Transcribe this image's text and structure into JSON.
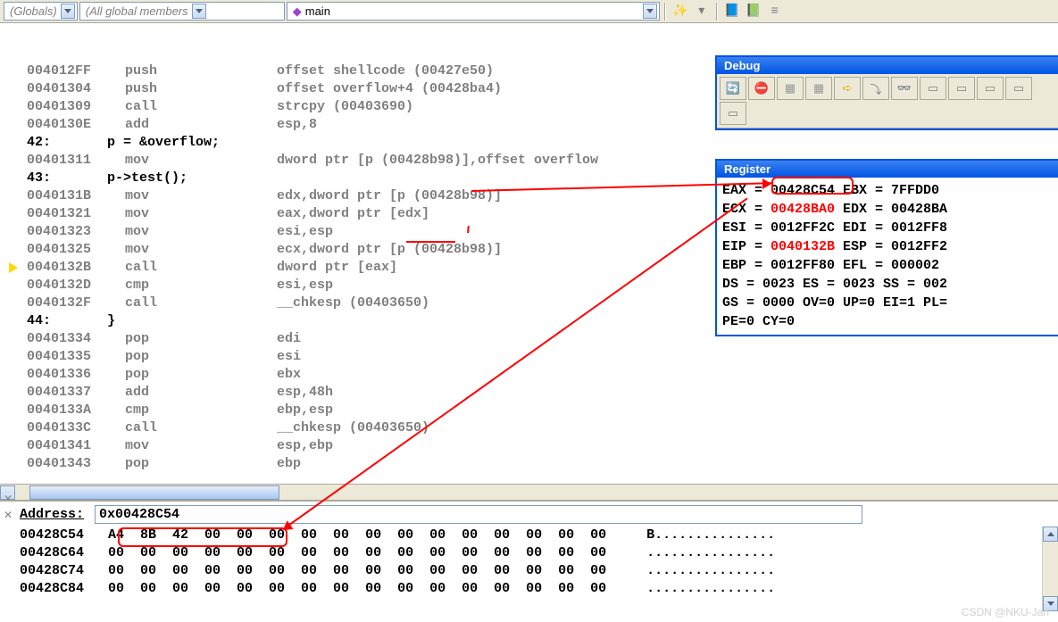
{
  "toolbar": {
    "combo1": "(Globals)",
    "combo2": "(All global members",
    "combo3": "main",
    "icons": [
      "wand-icon",
      "dropdown-icon",
      "book1-icon",
      "book2-icon",
      "list-icon"
    ]
  },
  "disasm": [
    {
      "addr": "004012FF",
      "mnem": "push",
      "oper": "offset shellcode (00427e50)"
    },
    {
      "addr": "00401304",
      "mnem": "push",
      "oper": "offset overflow+4 (00428ba4)"
    },
    {
      "addr": "00401309",
      "mnem": "call",
      "oper": "strcpy (00403690)"
    },
    {
      "addr": "0040130E",
      "mnem": "add",
      "oper": "esp,8"
    },
    {
      "src": "42:       p = &overflow;"
    },
    {
      "addr": "00401311",
      "mnem": "mov",
      "oper": "dword ptr [p (00428b98)],offset overflow"
    },
    {
      "src": "43:       p->test();"
    },
    {
      "addr": "0040131B",
      "mnem": "mov",
      "oper": "edx,dword ptr [p (00428b98)]"
    },
    {
      "addr": "00401321",
      "mnem": "mov",
      "oper": "eax,dword ptr [edx]"
    },
    {
      "addr": "00401323",
      "mnem": "mov",
      "oper": "esi,esp"
    },
    {
      "addr": "00401325",
      "mnem": "mov",
      "oper": "ecx,dword ptr [p (00428b98)]"
    },
    {
      "addr": "0040132B",
      "mnem": "call",
      "oper": "dword ptr [eax]",
      "current": true
    },
    {
      "addr": "0040132D",
      "mnem": "cmp",
      "oper": "esi,esp"
    },
    {
      "addr": "0040132F",
      "mnem": "call",
      "oper": "__chkesp (00403650)"
    },
    {
      "src": "44:       }"
    },
    {
      "addr": "00401334",
      "mnem": "pop",
      "oper": "edi"
    },
    {
      "addr": "00401335",
      "mnem": "pop",
      "oper": "esi"
    },
    {
      "addr": "00401336",
      "mnem": "pop",
      "oper": "ebx"
    },
    {
      "addr": "00401337",
      "mnem": "add",
      "oper": "esp,48h"
    },
    {
      "addr": "0040133A",
      "mnem": "cmp",
      "oper": "ebp,esp"
    },
    {
      "addr": "0040133C",
      "mnem": "call",
      "oper": "__chkesp (00403650)"
    },
    {
      "addr": "00401341",
      "mnem": "mov",
      "oper": "esp,ebp"
    },
    {
      "addr": "00401343",
      "mnem": "pop",
      "oper": "ebp"
    }
  ],
  "debug": {
    "title": "Debug"
  },
  "registers": {
    "title": "Register",
    "lines": [
      [
        {
          "t": "EAX = "
        },
        {
          "t": "00428C54",
          "boxed": true
        },
        {
          "t": " EBX = 7FFDD0"
        }
      ],
      [
        {
          "t": "ECX = "
        },
        {
          "t": "00428BA0",
          "red": true
        },
        {
          "t": " EDX = 00428BA"
        }
      ],
      [
        {
          "t": "ESI = 0012FF2C EDI = 0012FF8"
        }
      ],
      [
        {
          "t": "EIP = "
        },
        {
          "t": "0040132B",
          "red": true
        },
        {
          "t": " ESP = 0012FF2"
        }
      ],
      [
        {
          "t": "EBP = 0012FF80 EFL = 000002"
        }
      ],
      [
        {
          "t": "DS = 0023 ES = 0023 SS = 002"
        }
      ],
      [
        {
          "t": "GS = 0000 OV=0 UP=0 EI=1 PL="
        }
      ],
      [
        {
          "t": "PE=0 CY=0"
        }
      ]
    ]
  },
  "memory": {
    "label": "Address:",
    "input": "0x00428C54",
    "rows": [
      {
        "addr": "00428C54",
        "bytes": "A4 8B 42 00 00 00 00 00 00 00 00 00 00 00 00 00",
        "ascii": "B..............."
      },
      {
        "addr": "00428C64",
        "bytes": "00 00 00 00 00 00 00 00 00 00 00 00 00 00 00 00",
        "ascii": "................"
      },
      {
        "addr": "00428C74",
        "bytes": "00 00 00 00 00 00 00 00 00 00 00 00 00 00 00 00",
        "ascii": "................"
      },
      {
        "addr": "00428C84",
        "bytes": "00 00 00 00 00 00 00 00 00 00 00 00 00 00 00 00",
        "ascii": "................"
      }
    ]
  },
  "watermark": "CSDN @NKU-Jan"
}
